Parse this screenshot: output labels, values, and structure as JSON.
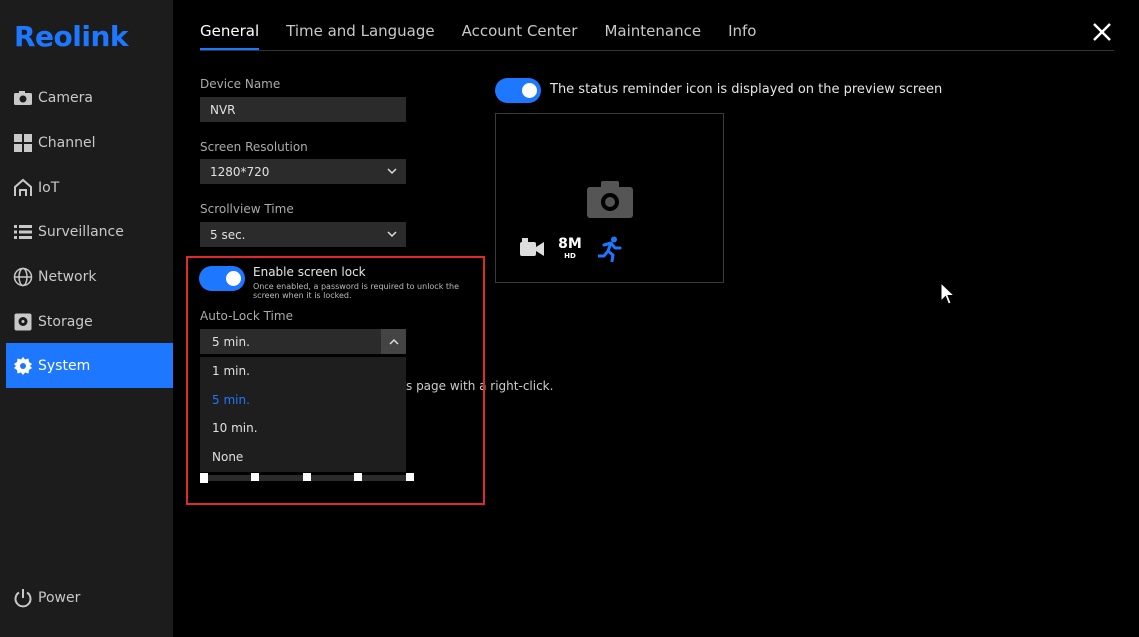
{
  "brand": {
    "logo_text": "Reolink",
    "accent": "#1e78ff"
  },
  "sidebar": {
    "items": [
      {
        "label": "Camera",
        "icon": "camera-icon"
      },
      {
        "label": "Channel",
        "icon": "grid-icon"
      },
      {
        "label": "IoT",
        "icon": "home-icon"
      },
      {
        "label": "Surveillance",
        "icon": "list-icon"
      },
      {
        "label": "Network",
        "icon": "globe-icon"
      },
      {
        "label": "Storage",
        "icon": "storage-icon"
      },
      {
        "label": "System",
        "icon": "gear-icon",
        "active": true
      }
    ],
    "power_label": "Power"
  },
  "tabs": [
    {
      "label": "General",
      "active": true
    },
    {
      "label": "Time and Language"
    },
    {
      "label": "Account Center"
    },
    {
      "label": "Maintenance"
    },
    {
      "label": "Info"
    }
  ],
  "general": {
    "device_name_label": "Device Name",
    "device_name_value": "NVR",
    "resolution_label": "Screen Resolution",
    "resolution_value": "1280*720",
    "scrollview_label": "Scrollview Time",
    "scrollview_value": "5 sec.",
    "screen_lock_label": "Enable screen lock",
    "screen_lock_desc": "Once enabled, a password is required to unlock the screen when it is locked.",
    "screen_lock_enabled": true,
    "autolock_label": "Auto-Lock Time",
    "autolock_value": "5 min.",
    "autolock_options": [
      "1 min.",
      "5 min.",
      "10 min.",
      "None"
    ],
    "autolock_selected": "5 min.",
    "hint_partial": "s page with a right-click."
  },
  "preview": {
    "status_reminder_label": "The status reminder icon is displayed on the preview screen",
    "status_reminder_enabled": true,
    "badge_resolution": "8M",
    "badge_hd": "HD"
  }
}
